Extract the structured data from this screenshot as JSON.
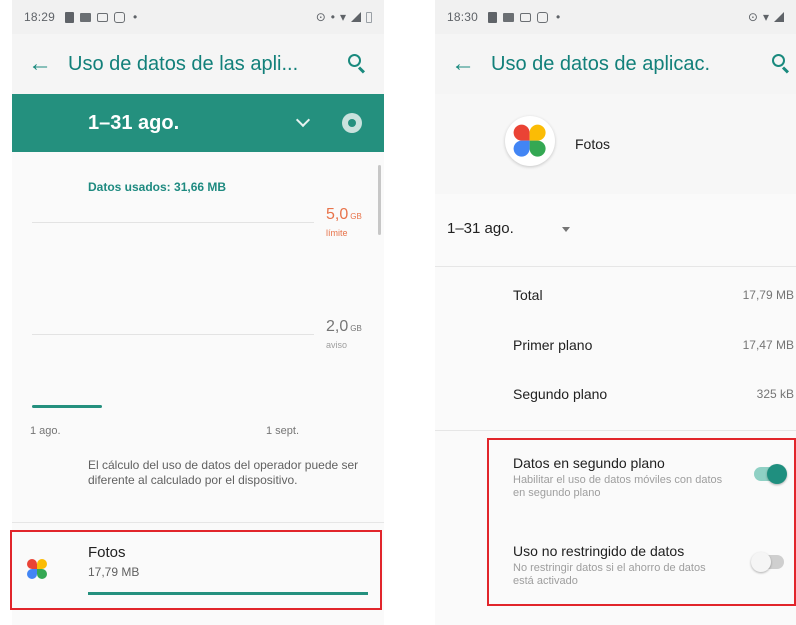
{
  "left": {
    "status": {
      "time": "18:29"
    },
    "appbar": {
      "title": "Uso de datos de las apli..."
    },
    "cycle": {
      "period": "1–31 ago."
    },
    "data_used": "Datos usados: 31,66 MB",
    "chart": {
      "limit_value": "5,0",
      "limit_unit": "GB",
      "limit_label": "límite",
      "warning_value": "2,0",
      "warning_unit": "GB",
      "warning_label": "aviso",
      "x_start": "1 ago.",
      "x_end": "1 sept."
    },
    "note": "El cálculo del uso de datos del operador puede ser diferente al calculado por el dispositivo.",
    "app": {
      "name": "Fotos",
      "size": "17,79 MB",
      "usage_fraction": 1.0
    },
    "colors": {
      "accent": "#24907e",
      "limit": "#e8734a",
      "highlight": "#e1252b"
    }
  },
  "right": {
    "status": {
      "time": "18:30"
    },
    "appbar": {
      "title": "Uso de datos de aplicac."
    },
    "app": {
      "name": "Fotos"
    },
    "period": "1–31 ago.",
    "stats": [
      {
        "label": "Total",
        "value": "17,79 MB"
      },
      {
        "label": "Primer plano",
        "value": "17,47 MB"
      },
      {
        "label": "Segundo plano",
        "value": "325 kB"
      }
    ],
    "toggles": [
      {
        "title": "Datos en segundo plano",
        "subtitle": "Habilitar el uso de datos móviles con datos en segundo plano",
        "state": "on"
      },
      {
        "title": "Uso no restringido de datos",
        "subtitle": "No restringir datos si el ahorro de datos está activado",
        "state": "off"
      }
    ]
  }
}
